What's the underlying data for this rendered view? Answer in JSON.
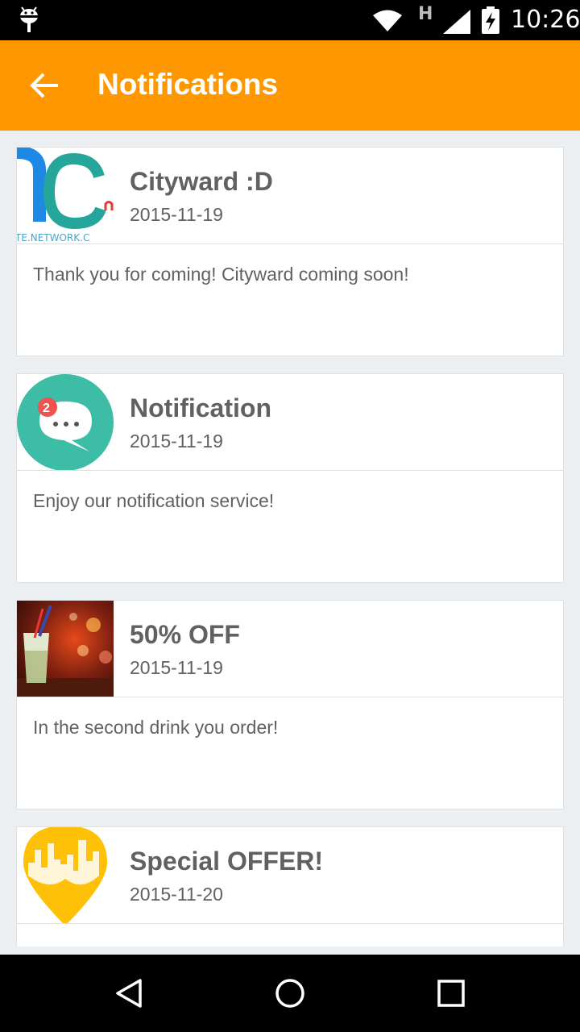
{
  "status_bar": {
    "time": "10:26",
    "network_type": "H",
    "icons": [
      "android-debug-icon",
      "wifi-icon",
      "signal-icon",
      "battery-charging-icon"
    ]
  },
  "app_bar": {
    "title": "Notifications",
    "back_icon": "arrow-back-icon",
    "color": "#ff9800"
  },
  "notifications": [
    {
      "title": "Cityward :D",
      "date": "2015-11-19",
      "body": "Thank you for coming! Cityward coming soon!",
      "thumb_text": "TE.NETWORK.C"
    },
    {
      "title": "Notification",
      "date": "2015-11-19",
      "body": "Enjoy our notification service!",
      "badge": "2"
    },
    {
      "title": "50% OFF",
      "date": "2015-11-19",
      "body": "In the second drink you order!"
    },
    {
      "title": "Special OFFER!",
      "date": "2015-11-20",
      "body": ""
    }
  ],
  "nav_bar": {
    "icons": [
      "back-triangle-icon",
      "home-circle-icon",
      "recents-square-icon"
    ]
  }
}
